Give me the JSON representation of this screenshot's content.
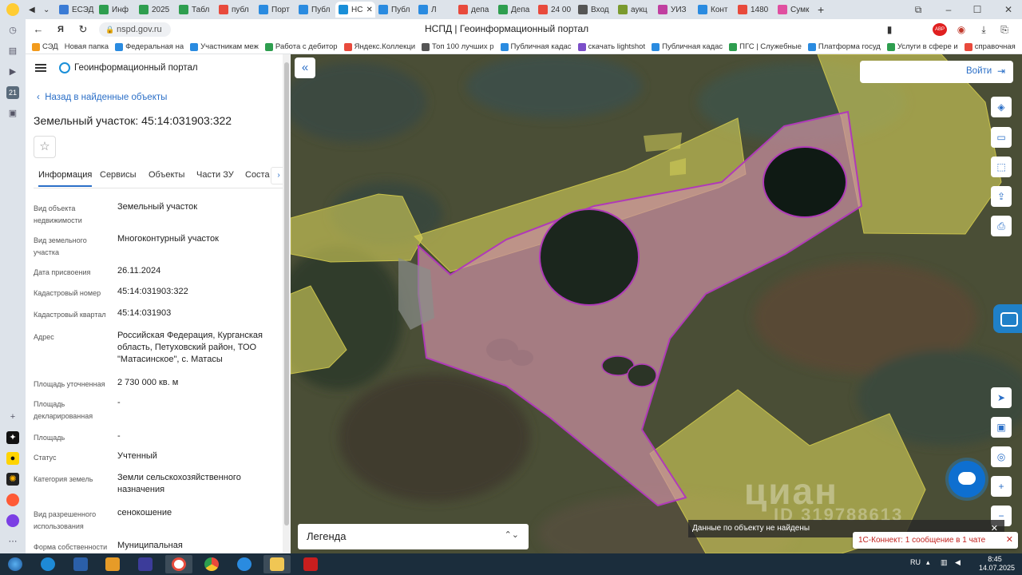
{
  "browser": {
    "tabs": [
      {
        "label": "ЕСЭД",
        "color": "#3a7bd5"
      },
      {
        "label": "Инф",
        "color": "#2e9e4f"
      },
      {
        "label": "2025",
        "color": "#2e9e4f"
      },
      {
        "label": "Табл",
        "color": "#2e9e4f"
      },
      {
        "label": "публ",
        "color": "#e84a3c"
      },
      {
        "label": "Порт",
        "color": "#2a8be0"
      },
      {
        "label": "Публ",
        "color": "#2a8be0"
      },
      {
        "label": "НС",
        "color": "#1a8fd8",
        "active": true
      },
      {
        "label": "Публ",
        "color": "#2a8be0"
      },
      {
        "label": "Л",
        "color": "#2a8be0"
      },
      {
        "label": "депа",
        "color": "#e84a3c"
      },
      {
        "label": "Депа",
        "color": "#2e9e4f"
      },
      {
        "label": "24 00",
        "color": "#e84a3c"
      },
      {
        "label": "Вход",
        "color": "#555"
      },
      {
        "label": "аукц",
        "color": "#7a9a2e"
      },
      {
        "label": "УИЗ",
        "color": "#c03fa0"
      },
      {
        "label": "Конт",
        "color": "#2a8be0"
      },
      {
        "label": "1480",
        "color": "#e84a3c"
      },
      {
        "label": "Сумк",
        "color": "#e04fa0"
      }
    ],
    "close_tab": "✕",
    "new_tab": "+",
    "url": "nspd.gov.ru",
    "title": "НСПД | Геоинформационный портал",
    "abp_badge": "ABP",
    "login_badge": "Войти",
    "bookmarks": [
      {
        "label": "СЭД",
        "color": "#f29b1d"
      },
      {
        "label": "Новая папка",
        "color": ""
      },
      {
        "label": "Федеральная на",
        "color": "#2a8be0"
      },
      {
        "label": "Участникам меж",
        "color": "#2a8be0"
      },
      {
        "label": "Работа с дебитор",
        "color": "#2e9e4f"
      },
      {
        "label": "Яндекс.Коллекци",
        "color": "#e84a3c"
      },
      {
        "label": "Топ 100 лучших р",
        "color": "#555"
      },
      {
        "label": "Публичная кадас",
        "color": "#2a8be0"
      },
      {
        "label": "скачать lightshot",
        "color": "#7b4fc9"
      },
      {
        "label": "Публичная кадас",
        "color": "#2a8be0"
      },
      {
        "label": "ПГС | Служебные",
        "color": "#2e9e4f"
      },
      {
        "label": "Платформа госуд",
        "color": "#2a8be0"
      },
      {
        "label": "Услуги в сфере и",
        "color": "#2e9e4f"
      },
      {
        "label": "справочная",
        "color": "#e84a3c"
      }
    ]
  },
  "panel": {
    "portal_name": "Геоинформационный портал",
    "back_link": "Назад в найденные объекты",
    "title": "Земельный участок: 45:14:031903:322",
    "tabs": [
      "Информация",
      "Сервисы",
      "Объекты",
      "Части ЗУ",
      "Соста"
    ],
    "fields": [
      {
        "label": "Вид объекта недвижимости",
        "value": "Земельный участок"
      },
      {
        "label": "Вид земельного участка",
        "value": "Многоконтурный участок"
      },
      {
        "label": "Дата присвоения",
        "value": "26.11.2024"
      },
      {
        "label": "Кадастровый номер",
        "value": "45:14:031903:322"
      },
      {
        "label": "Кадастровый квартал",
        "value": "45:14:031903"
      },
      {
        "label": "Адрес",
        "value": "Российская Федерация, Курганская область, Петуховский район, ТОО \"Матасинское\", с. Матасы"
      },
      {
        "label": "Площадь уточненная",
        "value": "2 730 000 кв. м"
      },
      {
        "label": "Площадь декларированная",
        "value": "-"
      },
      {
        "label": "Площадь",
        "value": "-"
      },
      {
        "label": "Статус",
        "value": "Учтенный"
      },
      {
        "label": "Категория земель",
        "value": "Земли сельскохозяйственного назначения"
      },
      {
        "label": "Вид разрешенного использования",
        "value": "сенокошение"
      },
      {
        "label": "Форма собственности",
        "value": "Муниципальная"
      }
    ]
  },
  "map": {
    "login_label": "Войти",
    "legend_label": "Легенда",
    "not_found": "Данные по объекту не найдены",
    "toast": "1С-Коннект: 1 сообщение в 1 чате",
    "watermark": "циан",
    "watermark_id": "ID 319788613",
    "colors": {
      "parcel_fill": "#c98fa0",
      "parcel_stroke": "#b03ab8",
      "field_fill": "#d7d25a"
    }
  },
  "taskbar": {
    "lang": "RU",
    "time": "8:45",
    "date": "14.07.2025"
  }
}
